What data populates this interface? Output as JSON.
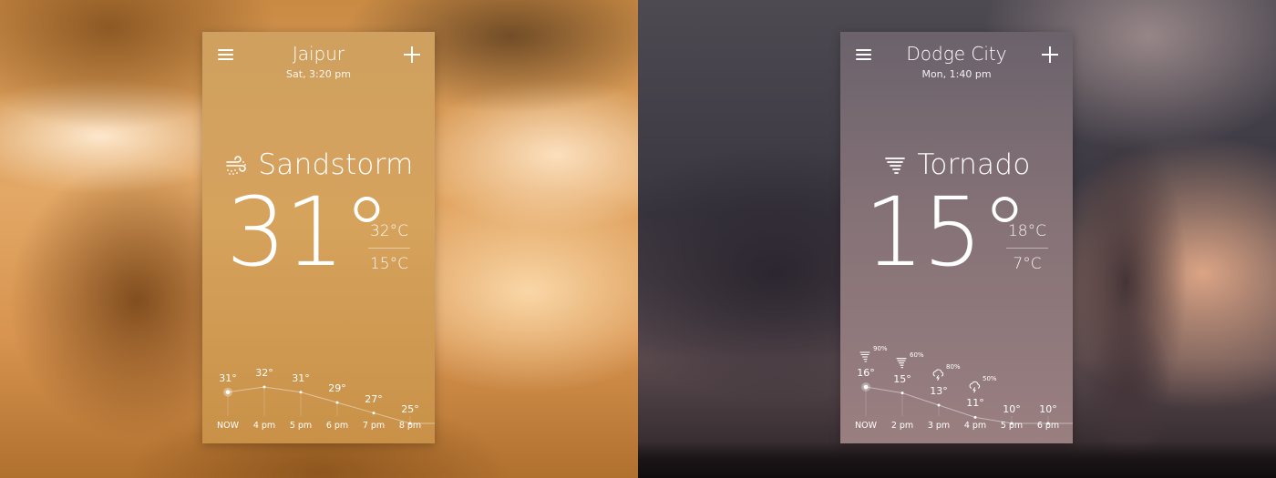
{
  "panels": [
    {
      "id": "left",
      "city": "Jaipur",
      "datetime": "Sat, 3:20 pm",
      "condition": "Sandstorm",
      "condition_icon": "sandstorm-icon",
      "temperature": "31°",
      "high": "32°C",
      "low": "15°C",
      "forecast": [
        {
          "time": "NOW",
          "temp": "31°",
          "value": 31
        },
        {
          "time": "4 pm",
          "temp": "32°",
          "value": 32
        },
        {
          "time": "5 pm",
          "temp": "31°",
          "value": 31
        },
        {
          "time": "6 pm",
          "temp": "29°",
          "value": 29
        },
        {
          "time": "7 pm",
          "temp": "27°",
          "value": 27
        },
        {
          "time": "8 pm",
          "temp": "25°",
          "value": 25
        }
      ]
    },
    {
      "id": "right",
      "city": "Dodge City",
      "datetime": "Mon, 1:40 pm",
      "condition": "Tornado",
      "condition_icon": "tornado-icon",
      "temperature": "15°",
      "high": "18°C",
      "low": "7°C",
      "forecast": [
        {
          "time": "NOW",
          "temp": "16°",
          "value": 16,
          "icon": "tornado-icon",
          "precip": "90%"
        },
        {
          "time": "2 pm",
          "temp": "15°",
          "value": 15,
          "icon": "tornado-icon",
          "precip": "60%"
        },
        {
          "time": "3 pm",
          "temp": "13°",
          "value": 13,
          "icon": "thunderstorm-icon",
          "precip": "80%"
        },
        {
          "time": "4 pm",
          "temp": "11°",
          "value": 11,
          "icon": "thunderstorm-icon",
          "precip": "50%"
        },
        {
          "time": "5 pm",
          "temp": "10°",
          "value": 10
        },
        {
          "time": "6 pm",
          "temp": "10°",
          "value": 10
        }
      ]
    }
  ]
}
